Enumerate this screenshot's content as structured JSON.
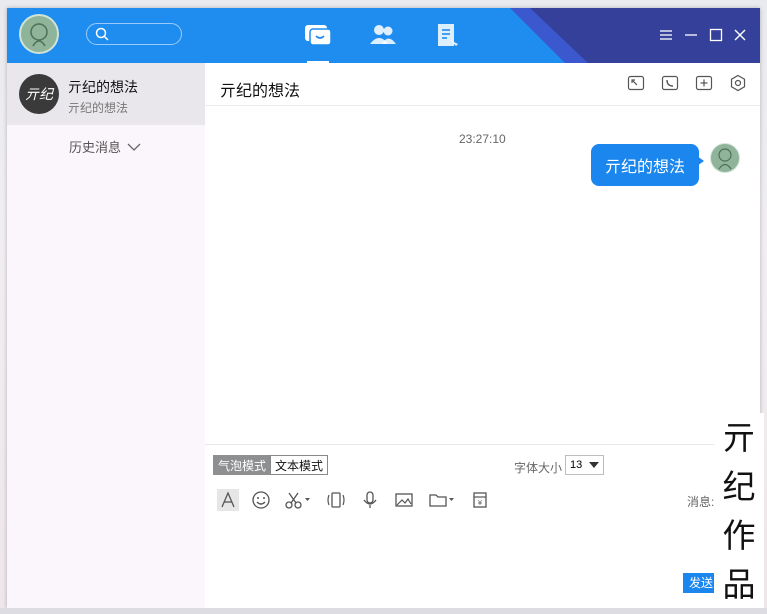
{
  "app": {
    "search": {
      "placeholder": ""
    },
    "nav_tabs": [
      {
        "name": "messages",
        "icon": "chat-bubble-icon",
        "active": true
      },
      {
        "name": "contacts",
        "icon": "contacts-icon",
        "active": false
      },
      {
        "name": "notes",
        "icon": "document-icon",
        "active": false
      }
    ],
    "window_controls": [
      "menu-icon",
      "minimize-icon",
      "maximize-icon",
      "close-icon"
    ]
  },
  "sidebar": {
    "conversation": {
      "avatar_text": "亓纪",
      "name": "亓纪的想法",
      "preview": "亓纪的想法"
    },
    "history_label": "历史消息"
  },
  "chat": {
    "title": "亓纪的想法",
    "header_icons": [
      "screenshot-icon",
      "phone-icon",
      "add-member-icon",
      "settings-icon"
    ],
    "timestamp": "23:27:10",
    "message": "亓纪的想法"
  },
  "composer": {
    "bubble_mode": "气泡模式",
    "text_mode": "文本模式",
    "font_size_label": "字体大小",
    "font_size": "13",
    "tools": [
      "font-icon",
      "emoji-icon",
      "scissors-icon",
      "shake-icon",
      "mic-icon",
      "image-icon",
      "folder-icon",
      "red-packet-icon"
    ],
    "message_label": "消息:",
    "send_label": "发送"
  },
  "watermark": [
    "亓",
    "纪",
    "作",
    "品"
  ],
  "colors": {
    "brand_blue": "#1f8df0",
    "bubble_blue": "#1a86ee",
    "dark_corner": "#34409a"
  }
}
